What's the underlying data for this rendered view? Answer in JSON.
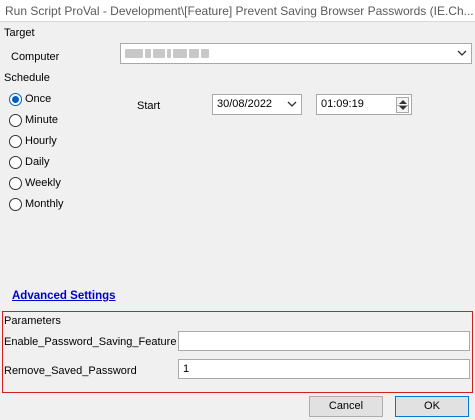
{
  "window": {
    "title": "Run Script ProVal - Development\\[Feature] Prevent Saving Browser Passwords (IE.Ch..."
  },
  "target": {
    "group_label": "Target",
    "computer_label": "Computer",
    "computer_value": ""
  },
  "schedule": {
    "group_label": "Schedule",
    "options": [
      {
        "label": "Once",
        "checked": true
      },
      {
        "label": "Minute",
        "checked": false
      },
      {
        "label": "Hourly",
        "checked": false
      },
      {
        "label": "Daily",
        "checked": false
      },
      {
        "label": "Weekly",
        "checked": false
      },
      {
        "label": "Monthly",
        "checked": false
      }
    ],
    "start_label": "Start",
    "start_date": "30/08/2022",
    "start_time": "01:09:19"
  },
  "advanced_settings_link": "Advanced Settings",
  "parameters": {
    "group_label": "Parameters",
    "fields": [
      {
        "label": "Enable_Password_Saving_Feature",
        "value": ""
      },
      {
        "label": "Remove_Saved_Password",
        "value": "1"
      }
    ]
  },
  "buttons": {
    "cancel": "Cancel",
    "ok": "OK"
  },
  "colors": {
    "highlight_box": "#d02020",
    "link": "#0000cc",
    "radio_selected": "#0060c0"
  }
}
